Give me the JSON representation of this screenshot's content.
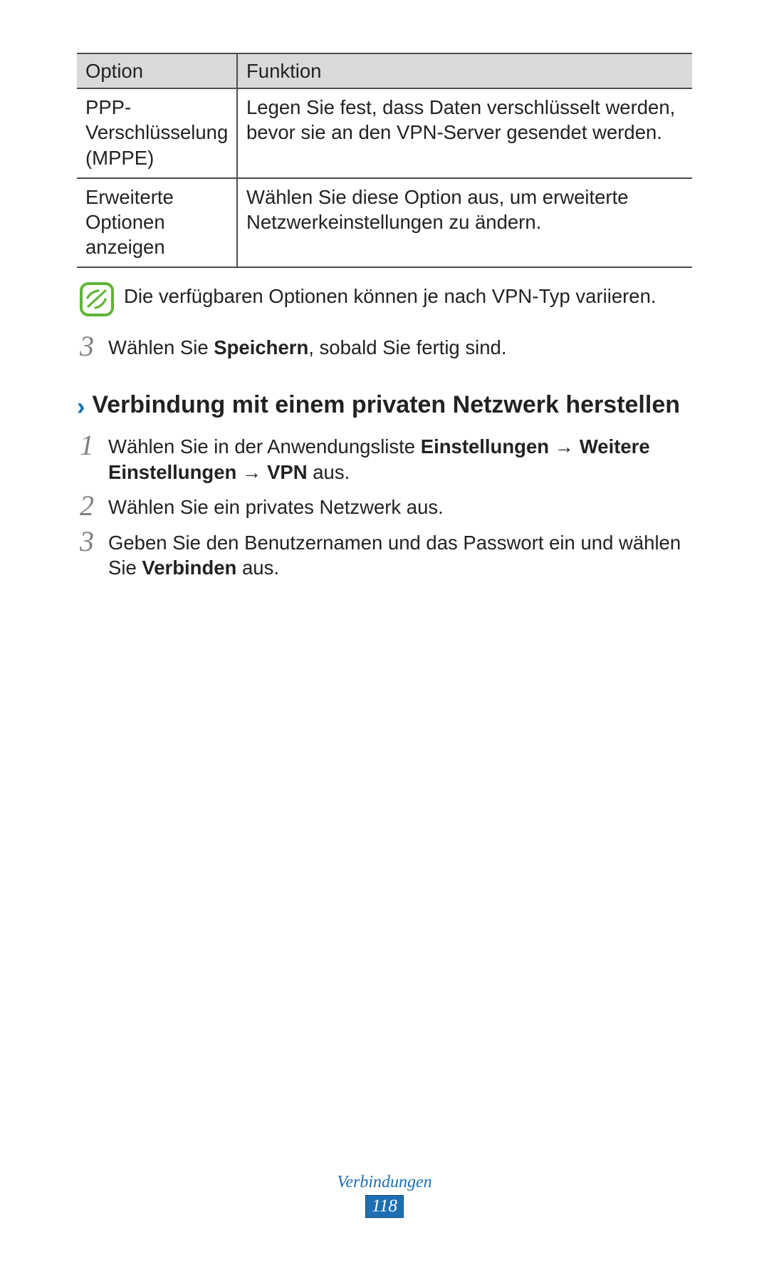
{
  "table": {
    "headers": {
      "col1": "Option",
      "col2": "Funktion"
    },
    "rows": [
      {
        "option": "PPP-Verschlüsselung (MPPE)",
        "function": "Legen Sie fest, dass Daten verschlüsselt werden, bevor sie an den VPN-Server gesendet werden."
      },
      {
        "option": "Erweiterte Optionen anzeigen",
        "function": "Wählen Sie diese Option aus, um erweiterte Netzwerkeinstellungen zu ändern."
      }
    ]
  },
  "note": "Die verfügbaren Optionen können je nach VPN-Typ variieren.",
  "step3_top": {
    "num": "3",
    "pre": "Wählen Sie ",
    "bold": "Speichern",
    "post": ", sobald Sie fertig sind."
  },
  "section_heading": "Verbindung mit einem privaten Netzwerk herstellen",
  "steps_bottom": {
    "s1": {
      "num": "1",
      "t1": "Wählen Sie in der Anwendungsliste ",
      "b1": "Einstellungen",
      "arrow1": " → ",
      "b2": "Weitere Einstellungen",
      "arrow2": " → ",
      "b3": "VPN",
      "t4": " aus."
    },
    "s2": {
      "num": "2",
      "text": "Wählen Sie ein privates Netzwerk aus."
    },
    "s3": {
      "num": "3",
      "t1": "Geben Sie den Benutzernamen und das Passwort ein und wählen Sie ",
      "b1": "Verbinden",
      "t2": " aus."
    }
  },
  "footer": {
    "section": "Verbindungen",
    "page": "118"
  }
}
